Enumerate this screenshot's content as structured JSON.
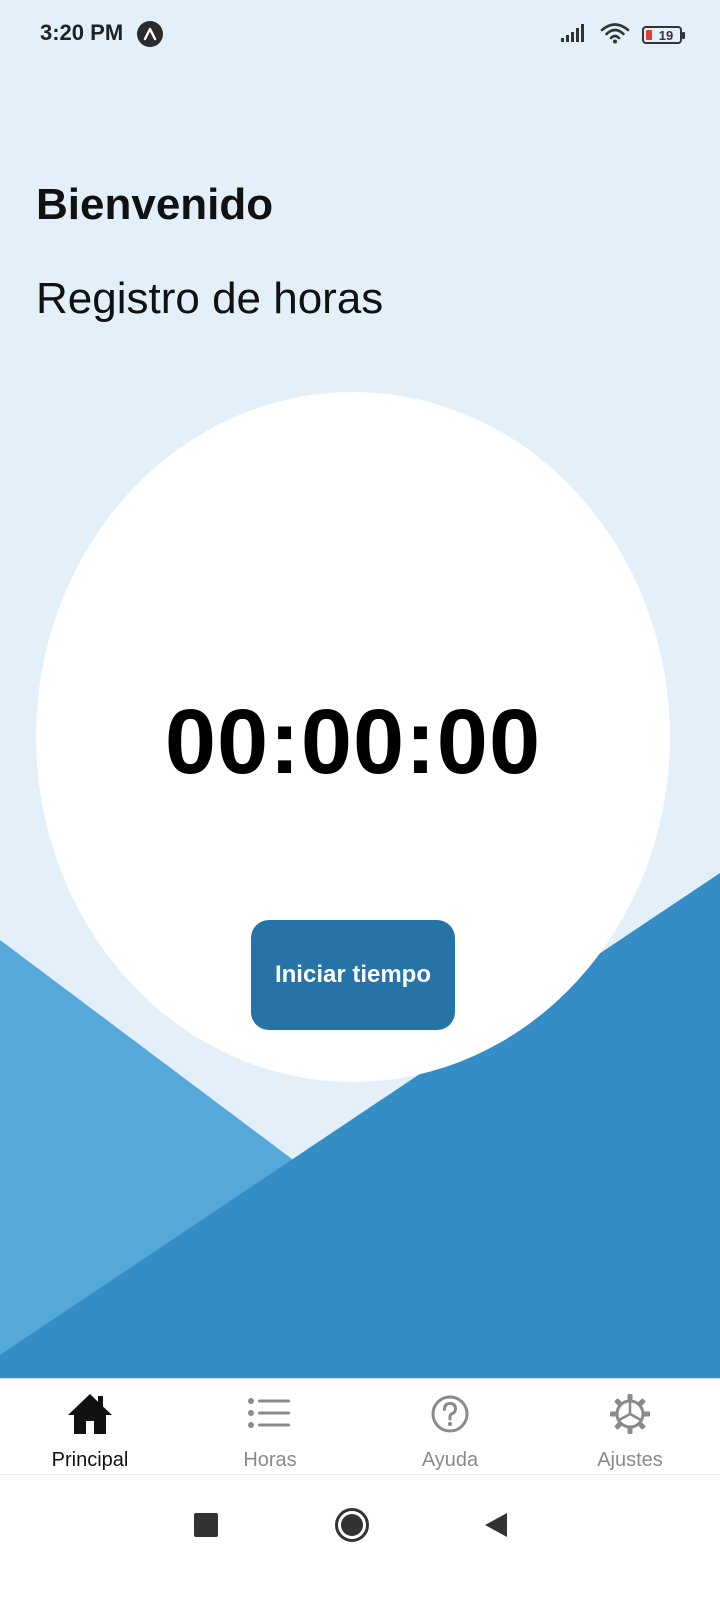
{
  "status_bar": {
    "time": "3:20 PM",
    "battery_level": "19",
    "icons": [
      "expo-go-icon",
      "signal-icon",
      "wifi-icon",
      "battery-icon"
    ]
  },
  "header": {
    "welcome": "Bienvenido",
    "subtitle": "Registro de horas"
  },
  "timer": {
    "display": "00:00:00",
    "start_label": "Iniciar tiempo"
  },
  "tabs": [
    {
      "label": "Principal",
      "icon": "home-icon",
      "active": true
    },
    {
      "label": "Horas",
      "icon": "list-icon",
      "active": false
    },
    {
      "label": "Ayuda",
      "icon": "help-icon",
      "active": false
    },
    {
      "label": "Ajustes",
      "icon": "settings-icon",
      "active": false
    }
  ],
  "navigation": {
    "buttons": [
      "recents-icon",
      "home-circle-icon",
      "back-icon"
    ]
  },
  "colors": {
    "background": "#e3eff9",
    "wave_light": "#56a7da",
    "wave_dark": "#348dc5",
    "button": "#2673a8",
    "active_tab": "#111111",
    "inactive_tab": "#8a8a8a"
  }
}
